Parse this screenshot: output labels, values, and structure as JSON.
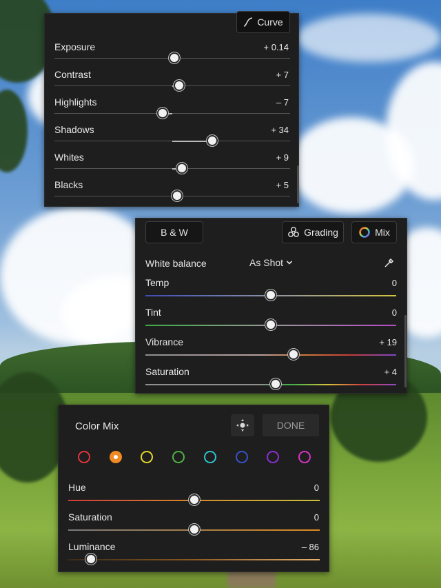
{
  "light_panel": {
    "curve_button": "Curve",
    "sliders": [
      {
        "label": "Exposure",
        "value": "+ 0.14",
        "position": 0.51
      },
      {
        "label": "Contrast",
        "value": "+ 7",
        "position": 0.53
      },
      {
        "label": "Highlights",
        "value": "– 7",
        "position": 0.46
      },
      {
        "label": "Shadows",
        "value": "+ 34",
        "position": 0.67
      },
      {
        "label": "Whites",
        "value": "+ 9",
        "position": 0.54
      },
      {
        "label": "Blacks",
        "value": "+ 5",
        "position": 0.52
      }
    ]
  },
  "color_panel": {
    "bw_button": "B & W",
    "grading_button": "Grading",
    "mix_button": "Mix",
    "white_balance_label": "White balance",
    "white_balance_value": "As Shot",
    "sliders": [
      {
        "label": "Temp",
        "value": "0",
        "position": 0.5,
        "gradient": "linear-gradient(90deg,#3c4cb8,#8c93a6,#d6c43c)"
      },
      {
        "label": "Tint",
        "value": "0",
        "position": 0.5,
        "gradient": "linear-gradient(90deg,#3aa845,#9b9b9b,#b54ac5)"
      },
      {
        "label": "Vibrance",
        "value": "+ 19",
        "position": 0.59,
        "gradient": "linear-gradient(90deg,#8f8f8f,#b6a0a0 45%,#d07a3b,#c83b3b,#7e48c7)"
      },
      {
        "label": "Saturation",
        "value": "+ 4",
        "position": 0.52,
        "gradient": "linear-gradient(90deg,#8f8f8f,#8f8f8f 45%,#3fb04a,#d5c53a,#cf4040,#8e49c7)"
      }
    ]
  },
  "color_mix": {
    "title": "Color Mix",
    "done_button": "DONE",
    "swatches": [
      {
        "name": "red",
        "color": "#e0343a",
        "selected": false
      },
      {
        "name": "orange",
        "color": "#f08a24",
        "selected": true
      },
      {
        "name": "yellow",
        "color": "#e6d72a",
        "selected": false
      },
      {
        "name": "green",
        "color": "#4fb546",
        "selected": false
      },
      {
        "name": "aqua",
        "color": "#2fc3d0",
        "selected": false
      },
      {
        "name": "blue",
        "color": "#3553c9",
        "selected": false
      },
      {
        "name": "purple",
        "color": "#8c2fd6",
        "selected": false
      },
      {
        "name": "magenta",
        "color": "#d634c8",
        "selected": false
      }
    ],
    "sliders": [
      {
        "label": "Hue",
        "value": "0",
        "position": 0.5,
        "gradient": "linear-gradient(90deg,#d13a3a,#d48a2a 50%,#c9c23a)"
      },
      {
        "label": "Saturation",
        "value": "0",
        "position": 0.5,
        "gradient": "linear-gradient(90deg,#7a7a7a,#b08040 60%,#e08a20)"
      },
      {
        "label": "Luminance",
        "value": "– 86",
        "position": 0.09,
        "gradient": "linear-gradient(90deg,#3a2a18,#8a5a20 50%,#e8b070)"
      }
    ]
  }
}
